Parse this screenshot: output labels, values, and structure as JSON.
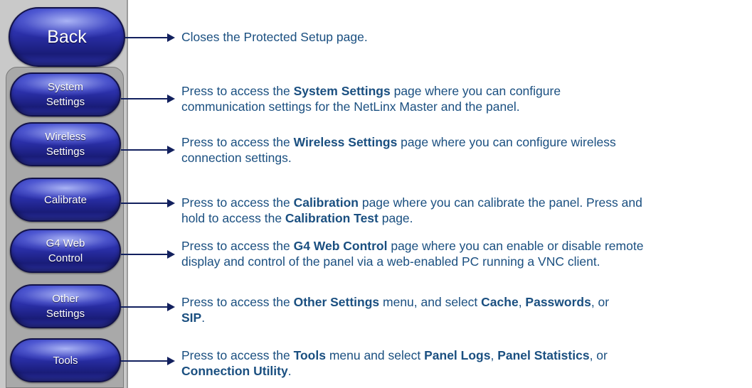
{
  "buttons": {
    "back": "Back",
    "system": "System\nSettings",
    "wireless": "Wireless\nSettings",
    "calibrate": "Calibrate",
    "g4": "G4 Web\nControl",
    "other": "Other\nSettings",
    "tools": "Tools"
  },
  "descriptions": {
    "back": {
      "t1": "Closes the Protected Setup page."
    },
    "system": {
      "t1": "Press to access the ",
      "b1": "System Settings",
      "t2": " page where you can configure",
      "t3": "communication settings for the NetLinx Master and the panel."
    },
    "wireless": {
      "t1": "Press to access the ",
      "b1": "Wireless Settings",
      "t2": " page where you can configure wireless",
      "t3": "connection settings."
    },
    "calibrate": {
      "t1": "Press to access the ",
      "b1": "Calibration",
      "t2": " page where you can calibrate the panel. Press and",
      "t3": "hold to access the ",
      "b2": "Calibration Test",
      "t4": " page."
    },
    "g4": {
      "t1": "Press to access the ",
      "b1": "G4 Web Control",
      "t2": " page where you can enable or disable remote",
      "t3": "display and control of the panel via a web-enabled PC running a VNC client."
    },
    "other": {
      "t1": "Press to access the ",
      "b1": "Other Settings",
      "t2": " menu, and select ",
      "b2": "Cache",
      "t3": ", ",
      "b3": "Passwords",
      "t4": ", or",
      "b4": "SIP",
      "t5": "."
    },
    "tools": {
      "t1": "Press to access the ",
      "b1": "Tools",
      "t2": " menu and select ",
      "b2": "Panel Logs",
      "t3": ", ",
      "b3": "Panel Statistics",
      "t4": ", or",
      "b4": "Connection Utility",
      "t5": "."
    }
  },
  "colors": {
    "text": "#1a4f80",
    "arrow": "#12205e",
    "button": "#2a2fa8"
  }
}
